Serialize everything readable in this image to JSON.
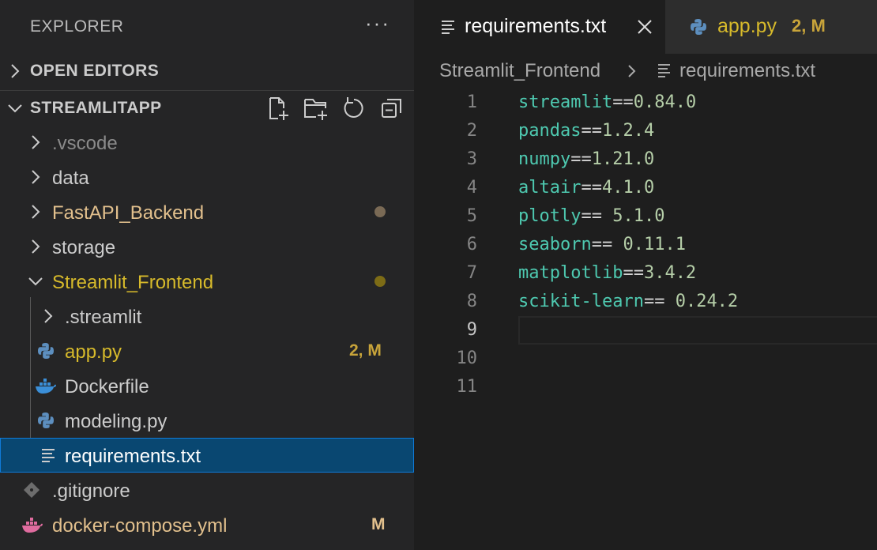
{
  "sidebar": {
    "title": "EXPLORER",
    "more_label": "···",
    "open_editors_label": "OPEN EDITORS",
    "project_label": "STREAMLITAPP",
    "actions": [
      "new-file-icon",
      "new-folder-icon",
      "refresh-icon",
      "collapse-all-icon"
    ],
    "tree": [
      {
        "name": ".vscode",
        "kind": "folder",
        "expanded": false,
        "color": "#8b8b8b"
      },
      {
        "name": "data",
        "kind": "folder",
        "expanded": false,
        "color": "#cccccc"
      },
      {
        "name": "FastAPI_Backend",
        "kind": "folder",
        "expanded": false,
        "color": "#e2c08d",
        "decoration": "dot",
        "dot_color": "#7a6a55"
      },
      {
        "name": "storage",
        "kind": "folder",
        "expanded": false,
        "color": "#cccccc"
      },
      {
        "name": "Streamlit_Frontend",
        "kind": "folder",
        "expanded": true,
        "color": "#d7ba2b",
        "decoration": "dot",
        "dot_color": "#7d6c16"
      },
      {
        "name": ".streamlit",
        "kind": "folder",
        "expanded": false,
        "color": "#cccccc"
      },
      {
        "name": "app.py",
        "kind": "file",
        "icon": "python-icon",
        "color": "#d7ba2b",
        "badge": "2, M",
        "badge_color": "#c8a43a"
      },
      {
        "name": "Dockerfile",
        "kind": "file",
        "icon": "docker-icon",
        "color": "#cccccc"
      },
      {
        "name": "modeling.py",
        "kind": "file",
        "icon": "python-icon",
        "color": "#cccccc"
      },
      {
        "name": "requirements.txt",
        "kind": "file",
        "icon": "text-file-icon",
        "color": "#ffffff",
        "selected": true
      },
      {
        "name": ".gitignore",
        "kind": "file",
        "icon": "git-icon",
        "color": "#cccccc"
      },
      {
        "name": "docker-compose.yml",
        "kind": "file",
        "icon": "docker-compose-icon",
        "color": "#e2c08d",
        "badge": "M",
        "badge_color": "#e2c08d"
      }
    ]
  },
  "editor": {
    "tabs": [
      {
        "label": "requirements.txt",
        "icon": "text-file-icon",
        "active": true
      },
      {
        "label": "app.py",
        "icon": "python-icon",
        "active": false,
        "badge": "2, M"
      }
    ],
    "breadcrumb": [
      "Streamlit_Frontend",
      "requirements.txt"
    ],
    "current_line": 9,
    "lines": [
      {
        "num": "1",
        "pkg": "streamlit",
        "op": "==",
        "ver": "0.84.0"
      },
      {
        "num": "2",
        "pkg": "pandas",
        "op": "==",
        "ver": "1.2.4"
      },
      {
        "num": "3",
        "pkg": "numpy",
        "op": "==",
        "ver": "1.21.0"
      },
      {
        "num": "4",
        "pkg": "altair",
        "op": "==",
        "ver": "4.1.0"
      },
      {
        "num": "5",
        "pkg": "plotly",
        "op": "== ",
        "ver": "5.1.0"
      },
      {
        "num": "6",
        "pkg": "seaborn",
        "op": "== ",
        "ver": "0.11.1"
      },
      {
        "num": "7",
        "pkg": "matplotlib",
        "op": "==",
        "ver": "3.4.2"
      },
      {
        "num": "8",
        "pkg": "scikit-learn",
        "op": "== ",
        "ver": "0.24.2"
      },
      {
        "num": "9",
        "pkg": "",
        "op": "",
        "ver": ""
      },
      {
        "num": "10",
        "pkg": "",
        "op": "",
        "ver": ""
      },
      {
        "num": "11",
        "pkg": "",
        "op": "",
        "ver": ""
      }
    ]
  }
}
